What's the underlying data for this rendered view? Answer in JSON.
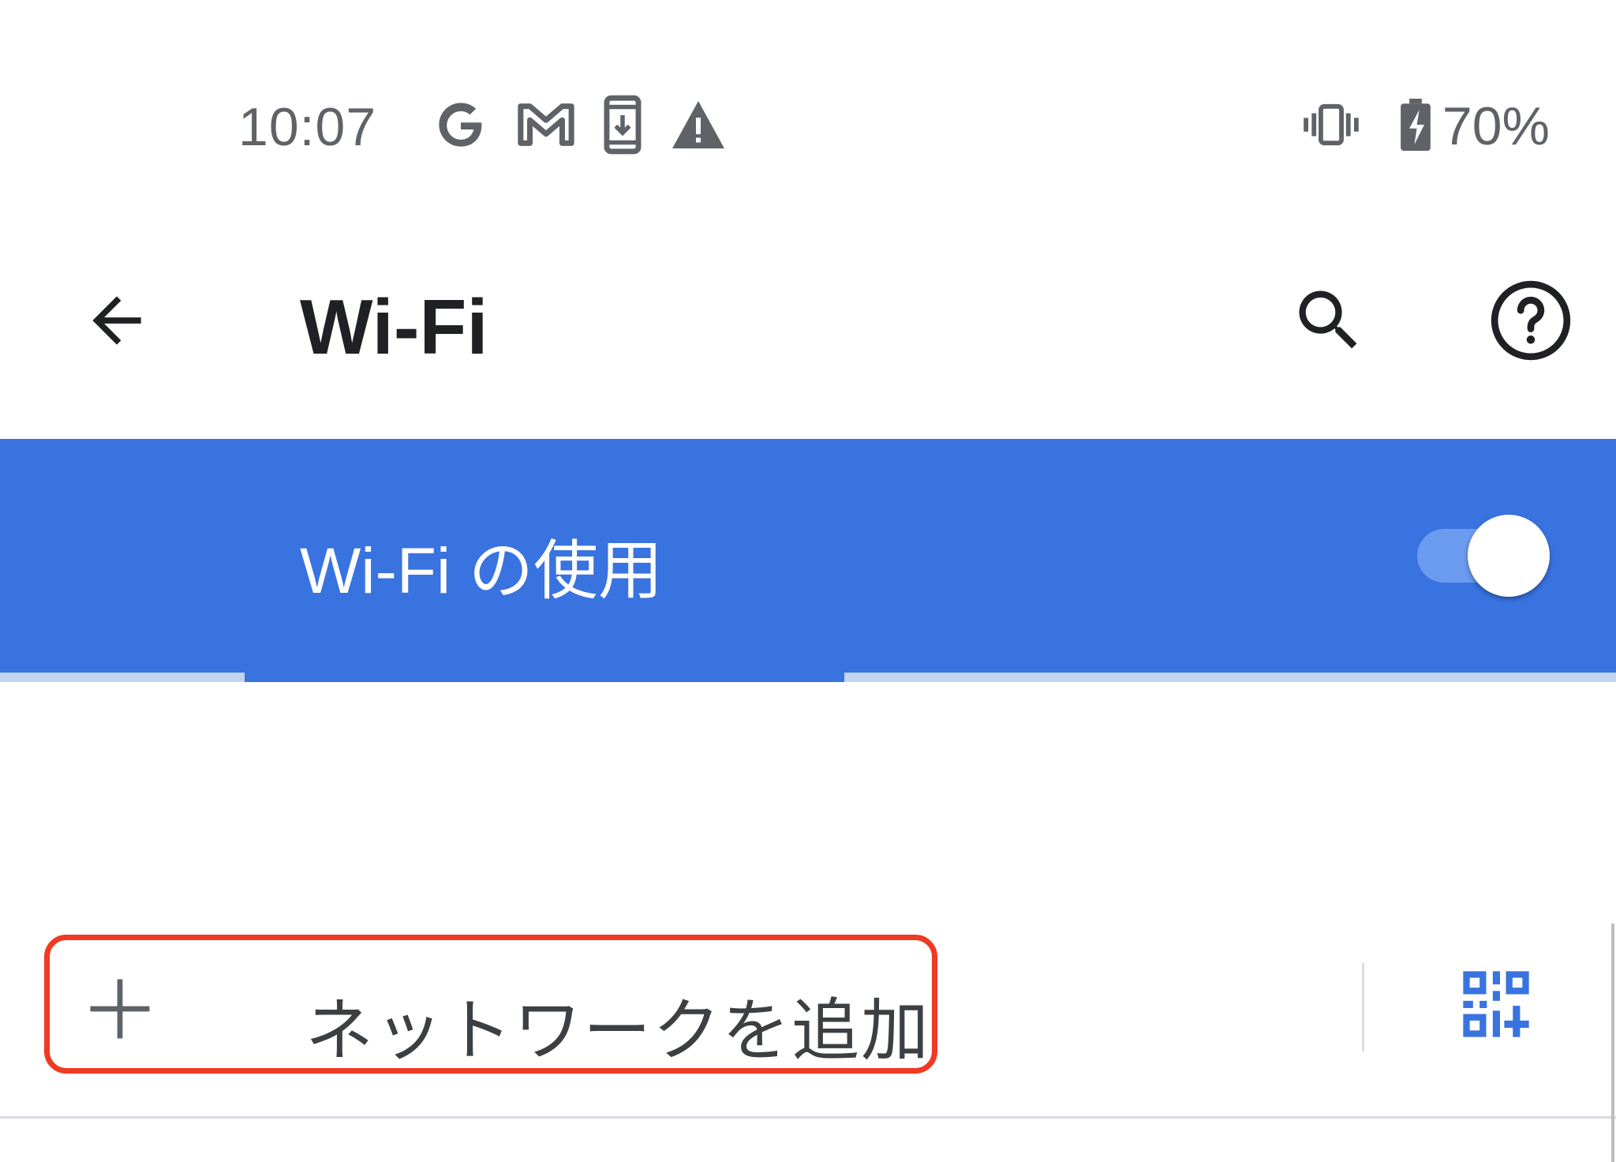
{
  "status_bar": {
    "time": "10:07",
    "left_icons": [
      "google-icon",
      "gmail-icon",
      "download-icon",
      "warning-icon"
    ],
    "right_icons": [
      "vibrate-icon",
      "battery-charging-icon"
    ],
    "battery_percent": "70%"
  },
  "app_bar": {
    "title": "Wi-Fi",
    "back_icon": "arrow-back-icon",
    "actions": [
      "search-icon",
      "help-icon"
    ]
  },
  "wifi_switch": {
    "label": "Wi-Fi の使用",
    "enabled": true,
    "accent_color": "#3973e0"
  },
  "add_network": {
    "label": "ネットワークを追加",
    "icon": "plus-icon",
    "qr_icon": "qr-code-scanner-icon",
    "highlight_color": "#ef3a24"
  }
}
